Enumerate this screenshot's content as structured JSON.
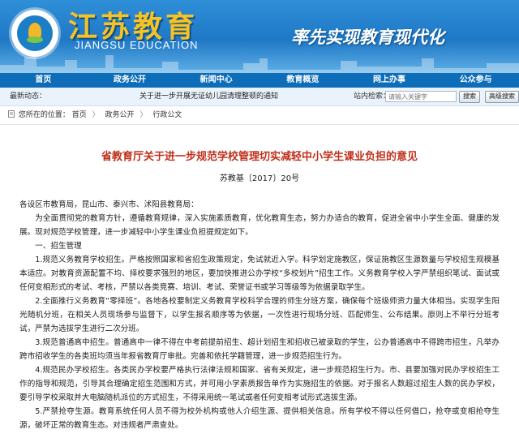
{
  "header": {
    "site_title": "江苏教育",
    "site_subtitle": "JIANGSU EDUCATION",
    "slogan": "率先实现教育现代化",
    "colors": {
      "accent": "#1f78c6",
      "title": "#f5c326",
      "nav": "#0e6db8",
      "article_title": "#c0301c"
    }
  },
  "nav": {
    "items": [
      "首页",
      "政务公开",
      "新闻中心",
      "教育概览",
      "网上办事",
      "公众参与"
    ]
  },
  "ticker": {
    "label": "最新动态：",
    "text": "关于进一步开展无证幼儿园清理整顿的通知"
  },
  "search": {
    "label": "站内检索：",
    "placeholder": "请输入关键字",
    "button": "搜索",
    "advanced_button": "高级搜索"
  },
  "breadcrumb": {
    "prefix": "您所在的位置：",
    "items": [
      "首页",
      "政务公开",
      "行政公文"
    ],
    "icon": "document-icon"
  },
  "article": {
    "title": "省教育厅关于进一步规范学校管理切实减轻中小学生课业负担的意见",
    "doc_number": "苏教基〔2017〕20号",
    "paragraphs": [
      "各设区市教育局，昆山市、泰兴市、沭阳县教育局：",
      "为全面贯彻党的教育方针，遵循教育规律，深入实施素质教育，优化教育生态，努力办适合的教育，促进全省中小学生全面、健康的发展。现对规范学校管理，进一步减轻中小学生课业负担提规定如下。",
      "一、招生管理",
      "1.规范义务教育学校招生。严格按照国家和省招生政策规定，免试就近入学。科学划定施教区，保证施教区生源数量与学校招生规模基本适应。对教育资源配置不均、择校要求强烈的地区，要加快推进公办学校“多校划片”招生工作。义务教育学校入学严禁组织笔试、面试或任何变相形式的考试、考核，严禁以各类竞赛、培训、考试、荣誉证书或学习等级等为依据录取学生。",
      "2.全面推行义务教育“零择班”。各地各校要制定义务教育学校科学合理的师生分班方案，确保每个班级师资力量大体相当。实现学生阳光随机分班，在相关人员现场参与监督下，以学生报名顺序等为依据，一次性进行现场分班、匹配师生、公布结果。原则上不举行分班考试，严禁为选拔学生进行二次分班。",
      "3.规范普通高中招生。普通高中一律不得在中考前提前招生、超计划招生和招收已被录取的学生，公办普通高中不得跨市招生，凡举办跨市招收学生的各类班均须当年报省教育厅审批。完善和依托学籍管理，进一步规范招生行为。",
      "4.规范民办学校招生。各类民办学校要严格执行法律法规和国家、省有关规定，进一步规范招生行为。市、县要加强对民办学校招生工作的指导和规范，引导其合理确定招生范围和方式，并可用小学素质报告单作为实施招生的依据。对于报名人数超过招生人数的民办学校，要引导学校采取并大电脑随机派位的方式招生，不得采用统一笔试或者任何变相考试形式选拔生源。",
      "5.严禁抢夺生源。教育系统任何人员不得为校外机构或他人介绍生源、提供相关信息。所有学校不得以任何借口，抢夺或变相抢夺生源，破坏正常的教育生态。对违规者严肃查处。"
    ]
  }
}
